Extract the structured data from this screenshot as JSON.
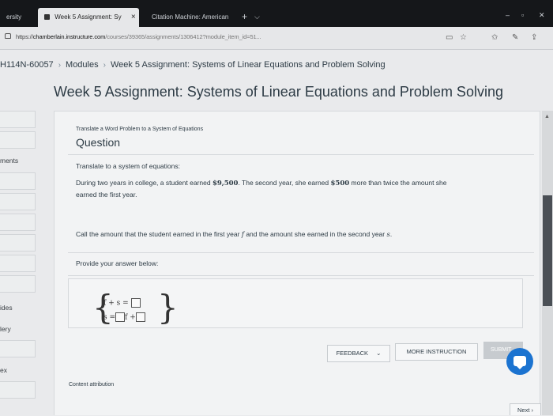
{
  "browser": {
    "tabs": [
      {
        "label": "ersity"
      },
      {
        "label": "Week 5 Assignment: Sy",
        "close": "×"
      },
      {
        "label": "Citation Machine: American"
      }
    ],
    "new_tab": "+",
    "url": {
      "scheme": "https://",
      "domain": "chamberlain.instructure.com",
      "path": "/courses/39365/assignments/1306412?module_item_id=51..."
    }
  },
  "breadcrumb": {
    "course": "H114N-60057",
    "modules": "Modules",
    "current": "Week 5 Assignment: Systems of Linear Equations and Problem Solving"
  },
  "page_title": "Week 5 Assignment: Systems of Linear Equations and Problem Solving",
  "left_nav": {
    "items": [
      "ments",
      "ides",
      "lery",
      "ex"
    ]
  },
  "question": {
    "small_title": "Translate a Word Problem to a System of Equations",
    "heading": "Question",
    "instruction": "Translate to a system of equations:",
    "problem_a": "During two years in college, a student earned ",
    "amount_total": "$9,500",
    "problem_b": ". The second year, she earned ",
    "amount_more": "$500",
    "problem_c": " more than twice the amount she",
    "problem_d": "earned the first year.",
    "call_a": "Call the amount that the student earned in the first year ",
    "var_f": "f",
    "call_b": " and the amount she earned in the second year ",
    "var_s": "s",
    "call_c": ".",
    "provide": "Provide your answer below:",
    "eq1_lhs": "f + s =",
    "eq2_lhs": "s =",
    "eq2_mid": "f +"
  },
  "buttons": {
    "feedback": "FEEDBACK",
    "feedback_caret": "⌄",
    "more_instruction": "MORE INSTRUCTION",
    "submit": "SUBMIT"
  },
  "content_attribution": "Content attribution",
  "next": "Next ›"
}
